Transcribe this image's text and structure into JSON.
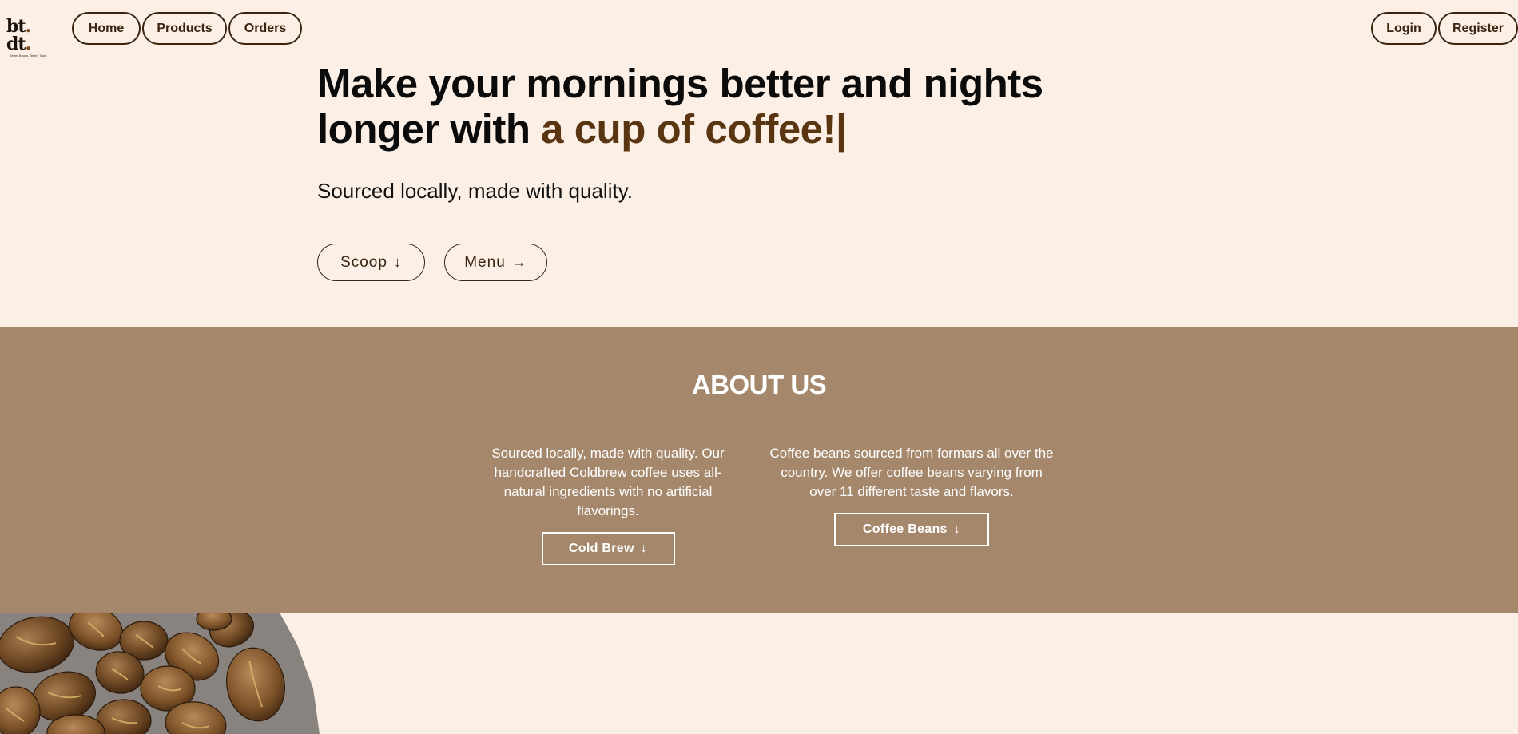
{
  "logo": {
    "mark_a": "bt",
    "mark_dot": ".",
    "mark_b": " dt",
    "mark_end": ".",
    "tagline": "Better Beans, Better Taste"
  },
  "nav": {
    "left": [
      {
        "label": "Home"
      },
      {
        "label": "Products"
      },
      {
        "label": "Orders"
      }
    ],
    "right": [
      {
        "label": "Login"
      },
      {
        "label": "Register"
      }
    ]
  },
  "hero": {
    "headline_main": "Make your mornings better and nights longer with ",
    "headline_accent": "a cup of coffee!",
    "cursor": "|",
    "subline": "Sourced locally, made with quality.",
    "buttons": [
      {
        "label": "Scoop",
        "icon": "arrow-down-icon"
      },
      {
        "label": "Menu",
        "icon": "arrow-right-icon"
      }
    ]
  },
  "about": {
    "title": "ABOUT US",
    "columns": [
      {
        "text": "Sourced locally, made with quality. Our handcrafted Coldbrew coffee uses all-natural ingredients with no artificial flavorings.",
        "button": "Cold Brew"
      },
      {
        "text": "Coffee beans sourced from formars all over the country. We offer coffee beans varying from over 11 different taste and flavors.",
        "button": "Coffee Beans"
      }
    ]
  },
  "colors": {
    "background": "#fcf0e6",
    "accent": "#5a3511",
    "about_band": "#a5886c",
    "nav_border": "#3a2410"
  }
}
